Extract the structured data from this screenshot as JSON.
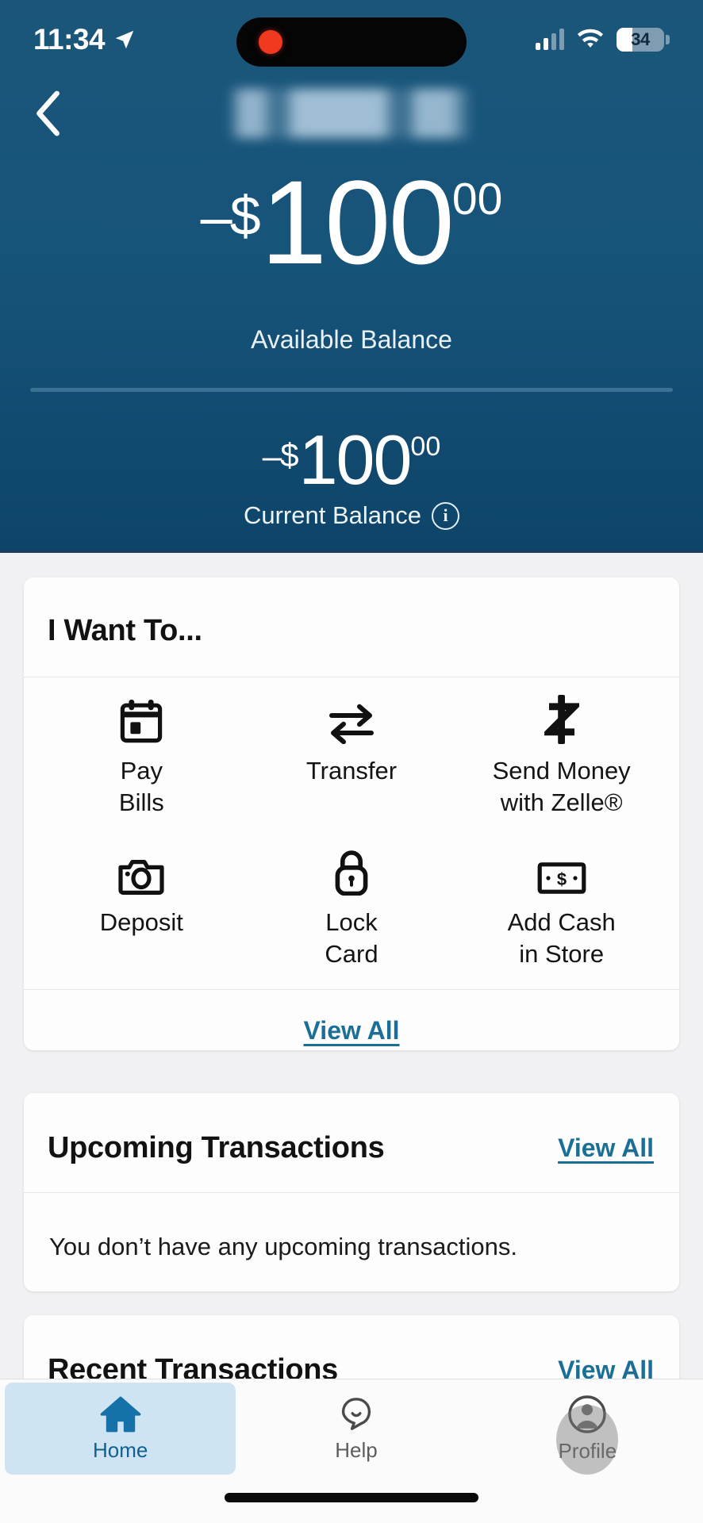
{
  "status_bar": {
    "time": "11:34",
    "location_icon": "location-arrow-icon",
    "recording_indicator": "recording-dot",
    "cellular_icon": "cellular-signal-icon",
    "wifi_icon": "wifi-icon",
    "battery_percent": "34"
  },
  "nav": {
    "back_icon": "chevron-left-icon",
    "account_title": ""
  },
  "balances": {
    "available": {
      "sign": "–",
      "dollar": "$",
      "whole": "100",
      "cents": "00",
      "label": "Available Balance"
    },
    "current": {
      "sign": "–",
      "dollar": "$",
      "whole": "100",
      "cents": "00",
      "label": "Current Balance",
      "info_icon": "info-circle-icon",
      "info_glyph": "i"
    }
  },
  "i_want_to": {
    "title": "I Want To...",
    "actions": [
      {
        "label": "Pay\nBills",
        "icon": "calendar-icon"
      },
      {
        "label": "Transfer",
        "icon": "transfer-arrows-icon"
      },
      {
        "label": "Send Money\nwith Zelle®",
        "icon": "zelle-icon"
      },
      {
        "label": "Deposit",
        "icon": "camera-icon"
      },
      {
        "label": "Lock\nCard",
        "icon": "lock-icon"
      },
      {
        "label": "Add Cash\nin Store",
        "icon": "cash-bill-icon"
      }
    ],
    "view_all": "View All"
  },
  "upcoming": {
    "title": "Upcoming Transactions",
    "view_all": "View All",
    "empty_message": "You don’t have any upcoming transactions."
  },
  "recent": {
    "title": "Recent Transactions",
    "view_all": "View All"
  },
  "tabbar": {
    "tabs": [
      {
        "label": "Home",
        "icon": "home-icon",
        "active": true
      },
      {
        "label": "Help",
        "icon": "chat-help-icon",
        "active": false
      },
      {
        "label": "Profile",
        "icon": "person-circle-icon",
        "active": false
      }
    ]
  },
  "colors": {
    "header_blue": "#17547a",
    "link_teal": "#1b6f96",
    "active_tab_bg": "#cfe4f2",
    "active_tab_blue": "#12608f",
    "page_bg": "#f1f1f3"
  }
}
